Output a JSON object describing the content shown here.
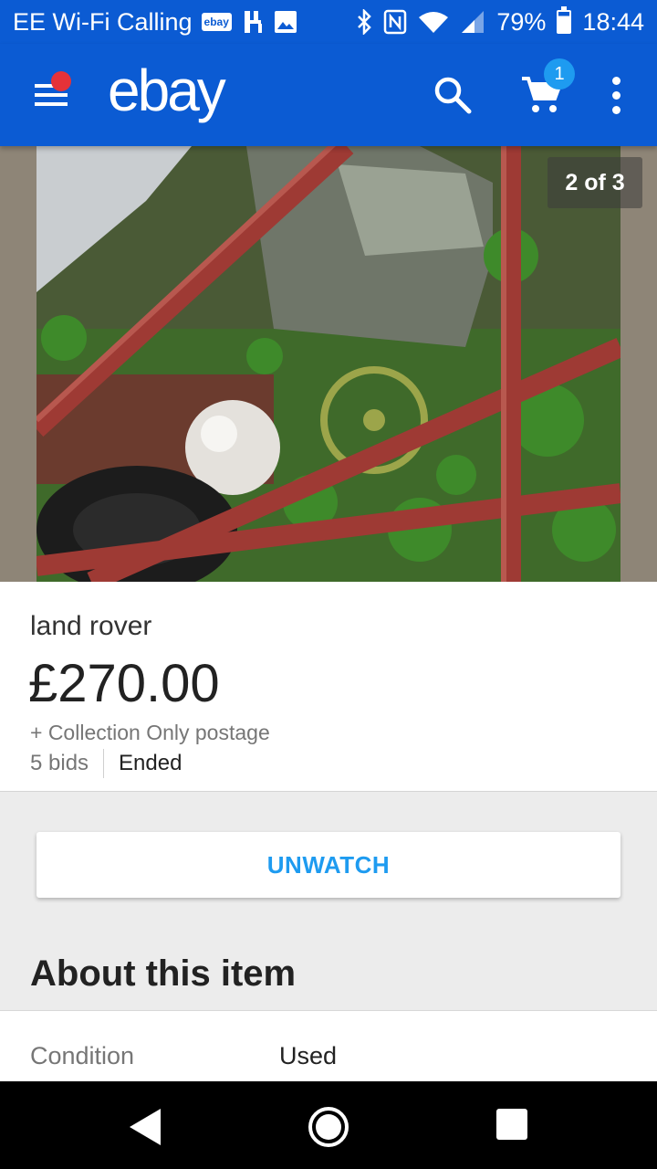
{
  "status_bar": {
    "carrier": "EE Wi-Fi Calling",
    "notification_icon_label": "ebay",
    "battery": "79%",
    "time": "18:44"
  },
  "app_bar": {
    "logo": "ebay",
    "cart_count": "1",
    "menu_has_notification": true,
    "colors": {
      "background": "#0b5bd3",
      "notification_dot": "#e53238",
      "badge": "#1e9bf0"
    }
  },
  "gallery": {
    "counter": "2 of 3",
    "current_index": 2,
    "total": 3
  },
  "item": {
    "title": "land rover",
    "price": "£270.00",
    "postage": "+ Collection Only postage",
    "bids": "5 bids",
    "status": "Ended"
  },
  "actions": {
    "unwatch_label": "UNWATCH",
    "accent_color": "#1e9bf0"
  },
  "about": {
    "heading": "About this item",
    "specs": [
      {
        "label": "Condition",
        "value": "Used"
      }
    ]
  },
  "icons": {
    "status_bar": [
      "ebay-notification-icon",
      "usb-debug-icon",
      "image-icon",
      "bluetooth-icon",
      "nfc-icon",
      "wifi-icon",
      "signal-icon",
      "battery-icon"
    ],
    "app_bar": [
      "menu-icon",
      "search-icon",
      "cart-icon",
      "more-vert-icon"
    ],
    "nav_bar": [
      "back-icon",
      "home-icon",
      "recents-icon"
    ]
  }
}
